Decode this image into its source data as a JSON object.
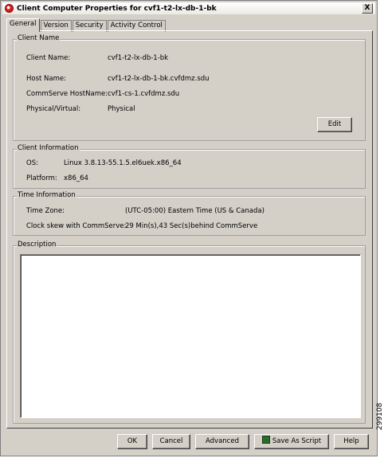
{
  "window": {
    "title": "Client Computer Properties for cvf1-t2-lx-db-1-bk",
    "close_label": "X"
  },
  "tabs": [
    {
      "label": "General"
    },
    {
      "label": "Version"
    },
    {
      "label": "Security"
    },
    {
      "label": "Activity Control"
    }
  ],
  "client_name_group": {
    "legend": "Client Name",
    "client_name_label": "Client Name:",
    "client_name_value": "cvf1-t2-lx-db-1-bk",
    "host_name_label": "Host Name:",
    "host_name_value": "cvf1-t2-lx-db-1-bk.cvfdmz.sdu",
    "commserve_label": "CommServe HostName:",
    "commserve_value": "cvf1-cs-1.cvfdmz.sdu",
    "physical_label": "Physical/Virtual:",
    "physical_value": "Physical",
    "edit_label": "Edit"
  },
  "client_info_group": {
    "legend": "Client Information",
    "os_label": "OS:",
    "os_value": "Linux 3.8.13-55.1.5.el6uek.x86_64",
    "platform_label": "Platform:",
    "platform_value": "x86_64"
  },
  "time_info_group": {
    "legend": "Time Information",
    "tz_label": "Time Zone:",
    "tz_value": "(UTC-05:00) Eastern Time (US & Canada)",
    "skew_label": "Clock skew with CommServe:",
    "skew_value": "29 Min(s),43 Sec(s)behind CommServe"
  },
  "description_group": {
    "legend": "Description",
    "text": ""
  },
  "buttons": {
    "ok": "OK",
    "cancel": "Cancel",
    "advanced": "Advanced",
    "save_script": "Save As Script",
    "help": "Help"
  },
  "side_number": "299108",
  "icons": {
    "app": "app-logo-icon",
    "script": "script-icon"
  }
}
